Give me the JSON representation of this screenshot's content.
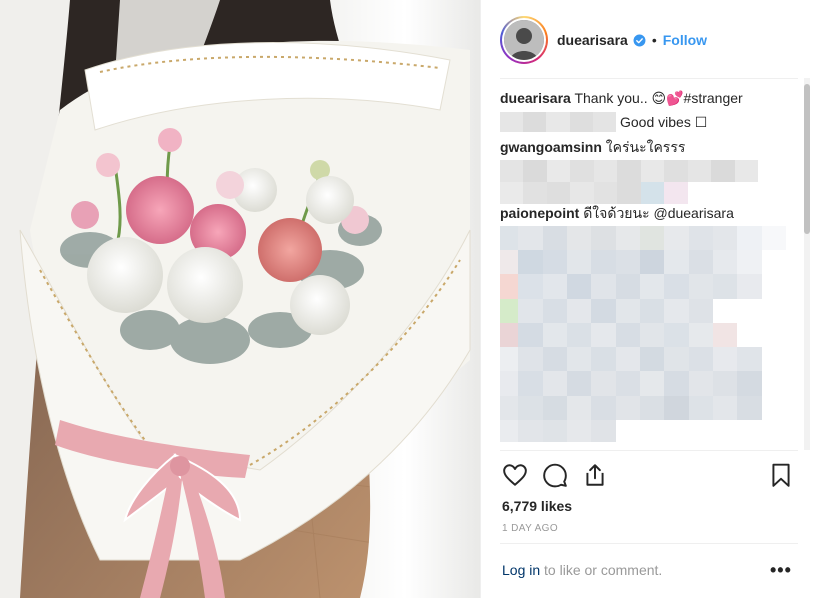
{
  "post": {
    "photo": {
      "icon": "bouquet-photo"
    },
    "header": {
      "username": "duearisara",
      "separator": "•",
      "follow_label": "Follow",
      "verified_icon": "verified-badge-icon"
    },
    "comments": [
      {
        "user": "duearisara",
        "text": "Thank you.. 😊💕#stranger"
      },
      {
        "user": "",
        "text": "Good vibes ☐"
      },
      {
        "user": "gwangoamsinn",
        "text": "ใคร่นะใครรร"
      },
      {
        "user": "paionepoint",
        "text": "ดีใจด้วยนะ @duearisara"
      }
    ],
    "actions": {
      "like_icon": "heart-icon",
      "comment_icon": "comment-icon",
      "share_icon": "share-icon",
      "save_icon": "bookmark-icon"
    },
    "likes_text": "6,779 likes",
    "timestamp": "1 DAY AGO",
    "login": {
      "link": "Log in",
      "suffix": " to like or comment.",
      "more_label": "•••"
    },
    "colors": {
      "accent": "#3897f0",
      "text": "#262626",
      "muted": "#999999",
      "ribbon": "#e8a9b0"
    }
  }
}
